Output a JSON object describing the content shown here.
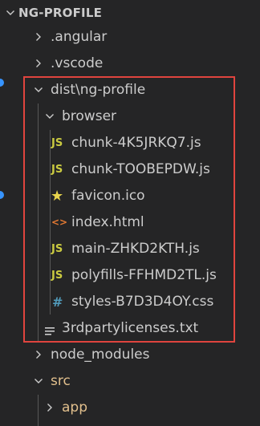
{
  "explorer": {
    "root_label": "NG-PROFILE",
    "items": [
      {
        "label": ".angular",
        "kind": "folder",
        "expanded": false
      },
      {
        "label": ".vscode",
        "kind": "folder",
        "expanded": false
      },
      {
        "label": "dist\\ng-profile",
        "kind": "folder",
        "expanded": true
      },
      {
        "label": "browser",
        "kind": "folder",
        "expanded": true
      },
      {
        "label": "chunk-4K5JRKQ7.js",
        "kind": "file",
        "icon_text": "JS",
        "icon": "javascript-file-icon"
      },
      {
        "label": "chunk-TOOBEPDW.js",
        "kind": "file",
        "icon_text": "JS",
        "icon": "javascript-file-icon"
      },
      {
        "label": "favicon.ico",
        "kind": "file",
        "icon_text": "★",
        "icon": "star-favicon-icon"
      },
      {
        "label": "index.html",
        "kind": "file",
        "icon_text": "<>",
        "icon": "html-file-icon"
      },
      {
        "label": "main-ZHKD2KTH.js",
        "kind": "file",
        "icon_text": "JS",
        "icon": "javascript-file-icon"
      },
      {
        "label": "polyfills-FFHMD2TL.js",
        "kind": "file",
        "icon_text": "JS",
        "icon": "javascript-file-icon"
      },
      {
        "label": "styles-B7D3D4OY.css",
        "kind": "file",
        "icon_text": "#",
        "icon": "css-file-icon"
      },
      {
        "label": "3rdpartylicenses.txt",
        "kind": "file",
        "icon_text": "",
        "icon": "text-file-icon"
      },
      {
        "label": "node_modules",
        "kind": "folder",
        "expanded": false
      },
      {
        "label": "src",
        "kind": "folder",
        "expanded": true,
        "color": "#e2c08d"
      },
      {
        "label": "app",
        "kind": "folder",
        "expanded": false,
        "color": "#e2c08d"
      }
    ]
  },
  "colors": {
    "background": "#252526",
    "text": "#cccccc",
    "js_icon": "#cbcb41",
    "star_icon": "#e8d44d",
    "html_icon": "#e37933",
    "css_icon": "#519aba",
    "highlight_border": "#e0443e",
    "modified_folder": "#e2c08d",
    "activity_dot": "#3794ff"
  }
}
